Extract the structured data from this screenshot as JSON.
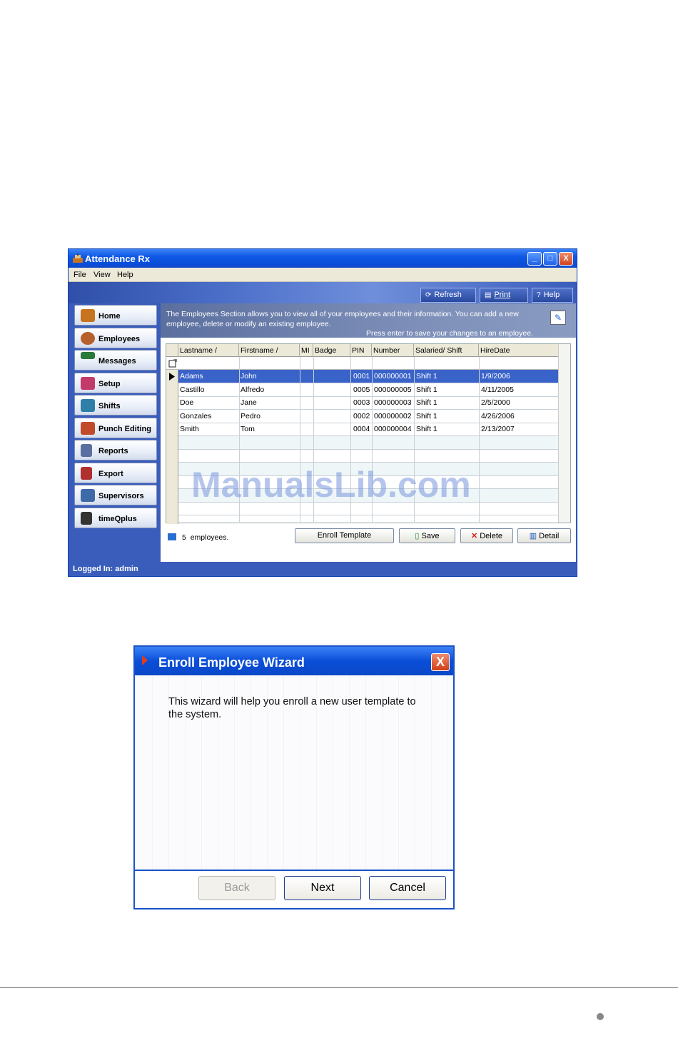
{
  "app": {
    "title": "Attendance Rx",
    "window_buttons": {
      "minimize": "_",
      "maximize": "□",
      "close": "X"
    },
    "menu": [
      "File",
      "View",
      "Help"
    ],
    "toolbar": {
      "refresh": "Refresh",
      "print": "Print",
      "help": "Help"
    },
    "sidebar": [
      {
        "label": "Home",
        "icon": "home-icon",
        "color": "#c8731f"
      },
      {
        "label": "Employees",
        "icon": "employee-icon",
        "color": "#b8602c"
      },
      {
        "label": "Messages",
        "icon": "messages-icon",
        "color": "#2a7a3a"
      },
      {
        "label": "Setup",
        "icon": "setup-icon",
        "color": "#c23a6a"
      },
      {
        "label": "Shifts",
        "icon": "shifts-icon",
        "color": "#2f7fa8"
      },
      {
        "label": "Punch Editing",
        "icon": "punch-editing-icon",
        "color": "#c04a2a"
      },
      {
        "label": "Reports",
        "icon": "reports-icon",
        "color": "#5a6fa0"
      },
      {
        "label": "Export",
        "icon": "export-icon",
        "color": "#b03030"
      },
      {
        "label": "Supervisors",
        "icon": "supervisors-icon",
        "color": "#3f6aa8"
      },
      {
        "label": "timeQplus",
        "icon": "timeqplus-icon",
        "color": "#333333"
      }
    ],
    "info_text": "The Employees Section allows you to view all of your employees and their information.  You can add a new employee, delete or modify an existing employee.",
    "info_hint": "Press enter to save your changes to an employee.",
    "grid": {
      "columns": [
        "Lastname",
        "Firstname",
        "MI",
        "Badge",
        "PIN",
        "Number",
        "Salaried/ Shift",
        "HireDate"
      ],
      "rows": [
        {
          "lastname": "Adams",
          "firstname": "John",
          "mi": "",
          "badge": "",
          "pin": "0001",
          "number": "000000001",
          "shift": "Shift 1",
          "hiredate": "1/9/2006"
        },
        {
          "lastname": "Castillo",
          "firstname": "Alfredo",
          "mi": "",
          "badge": "",
          "pin": "0005",
          "number": "000000005",
          "shift": "Shift 1",
          "hiredate": "4/11/2005"
        },
        {
          "lastname": "Doe",
          "firstname": "Jane",
          "mi": "",
          "badge": "",
          "pin": "0003",
          "number": "000000003",
          "shift": "Shift 1",
          "hiredate": "2/5/2000"
        },
        {
          "lastname": "Gonzales",
          "firstname": "Pedro",
          "mi": "",
          "badge": "",
          "pin": "0002",
          "number": "000000002",
          "shift": "Shift 1",
          "hiredate": "4/26/2006"
        },
        {
          "lastname": "Smith",
          "firstname": "Tom",
          "mi": "",
          "badge": "",
          "pin": "0004",
          "number": "000000004",
          "shift": "Shift 1",
          "hiredate": "2/13/2007"
        }
      ]
    },
    "employee_count": "5",
    "employee_count_label": "employees.",
    "buttons": {
      "enroll": "Enroll Template",
      "save": "Save",
      "delete": "Delete",
      "detail": "Detail"
    },
    "status": "Logged In: admin",
    "watermark": "ManualsLib.com"
  },
  "wizard": {
    "title": "Enroll Employee Wizard",
    "close": "X",
    "message": "This wizard will help you enroll a new user template to the system.",
    "back": "Back",
    "next": "Next",
    "cancel": "Cancel"
  }
}
